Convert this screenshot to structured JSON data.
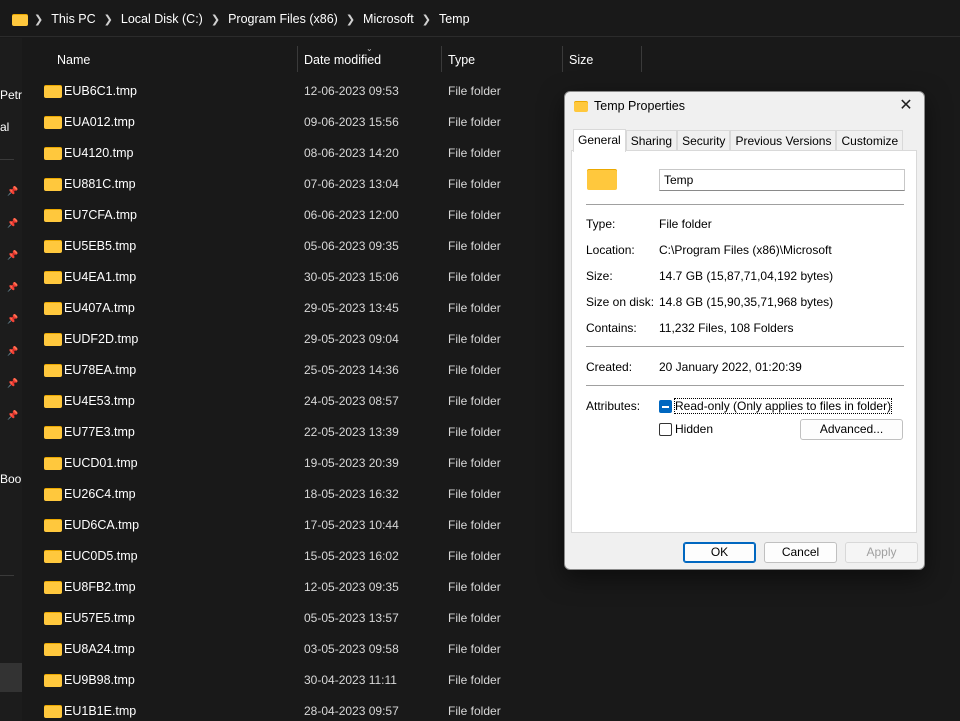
{
  "breadcrumb": [
    "This PC",
    "Local Disk (C:)",
    "Program Files (x86)",
    "Microsoft",
    "Temp"
  ],
  "nav": {
    "labels": [
      "Petr",
      "al",
      "Boo"
    ]
  },
  "columns": {
    "name": "Name",
    "date": "Date modified",
    "type": "Type",
    "size": "Size"
  },
  "files": [
    {
      "name": "EUB6C1.tmp",
      "date": "12-06-2023 09:53",
      "type": "File folder"
    },
    {
      "name": "EUA012.tmp",
      "date": "09-06-2023 15:56",
      "type": "File folder"
    },
    {
      "name": "EU4120.tmp",
      "date": "08-06-2023 14:20",
      "type": "File folder"
    },
    {
      "name": "EU881C.tmp",
      "date": "07-06-2023 13:04",
      "type": "File folder"
    },
    {
      "name": "EU7CFA.tmp",
      "date": "06-06-2023 12:00",
      "type": "File folder"
    },
    {
      "name": "EU5EB5.tmp",
      "date": "05-06-2023 09:35",
      "type": "File folder"
    },
    {
      "name": "EU4EA1.tmp",
      "date": "30-05-2023 15:06",
      "type": "File folder"
    },
    {
      "name": "EU407A.tmp",
      "date": "29-05-2023 13:45",
      "type": "File folder"
    },
    {
      "name": "EUDF2D.tmp",
      "date": "29-05-2023 09:04",
      "type": "File folder"
    },
    {
      "name": "EU78EA.tmp",
      "date": "25-05-2023 14:36",
      "type": "File folder"
    },
    {
      "name": "EU4E53.tmp",
      "date": "24-05-2023 08:57",
      "type": "File folder"
    },
    {
      "name": "EU77E3.tmp",
      "date": "22-05-2023 13:39",
      "type": "File folder"
    },
    {
      "name": "EUCD01.tmp",
      "date": "19-05-2023 20:39",
      "type": "File folder"
    },
    {
      "name": "EU26C4.tmp",
      "date": "18-05-2023 16:32",
      "type": "File folder"
    },
    {
      "name": "EUD6CA.tmp",
      "date": "17-05-2023 10:44",
      "type": "File folder"
    },
    {
      "name": "EUC0D5.tmp",
      "date": "15-05-2023 16:02",
      "type": "File folder"
    },
    {
      "name": "EU8FB2.tmp",
      "date": "12-05-2023 09:35",
      "type": "File folder"
    },
    {
      "name": "EU57E5.tmp",
      "date": "05-05-2023 13:57",
      "type": "File folder"
    },
    {
      "name": "EU8A24.tmp",
      "date": "03-05-2023 09:58",
      "type": "File folder"
    },
    {
      "name": "EU9B98.tmp",
      "date": "30-04-2023 11:11",
      "type": "File folder"
    },
    {
      "name": "EU1B1E.tmp",
      "date": "28-04-2023 09:57",
      "type": "File folder"
    }
  ],
  "dialog": {
    "title": "Temp Properties",
    "close_glyph": "✕",
    "tabs": [
      "General",
      "Sharing",
      "Security",
      "Previous Versions",
      "Customize"
    ],
    "active_tab": "General",
    "folder_name": "Temp",
    "props": {
      "type_label": "Type:",
      "type_value": "File folder",
      "location_label": "Location:",
      "location_value": "C:\\Program Files (x86)\\Microsoft",
      "size_label": "Size:",
      "size_value": "14.7 GB (15,87,71,04,192 bytes)",
      "sizeondisk_label": "Size on disk:",
      "sizeondisk_value": "14.8 GB (15,90,35,71,968 bytes)",
      "contains_label": "Contains:",
      "contains_value": "11,232 Files, 108 Folders",
      "created_label": "Created:",
      "created_value": "20 January 2022, 01:20:39",
      "attributes_label": "Attributes:"
    },
    "readonly_label": "Read-only (Only applies to files in folder)",
    "readonly_state": "indeterminate",
    "hidden_label": "Hidden",
    "hidden_checked": false,
    "advanced_label": "Advanced...",
    "ok_label": "OK",
    "cancel_label": "Cancel",
    "apply_label": "Apply"
  },
  "colors": {
    "folder": "#ffc83d",
    "accent": "#0067c0",
    "background": "#191919"
  }
}
